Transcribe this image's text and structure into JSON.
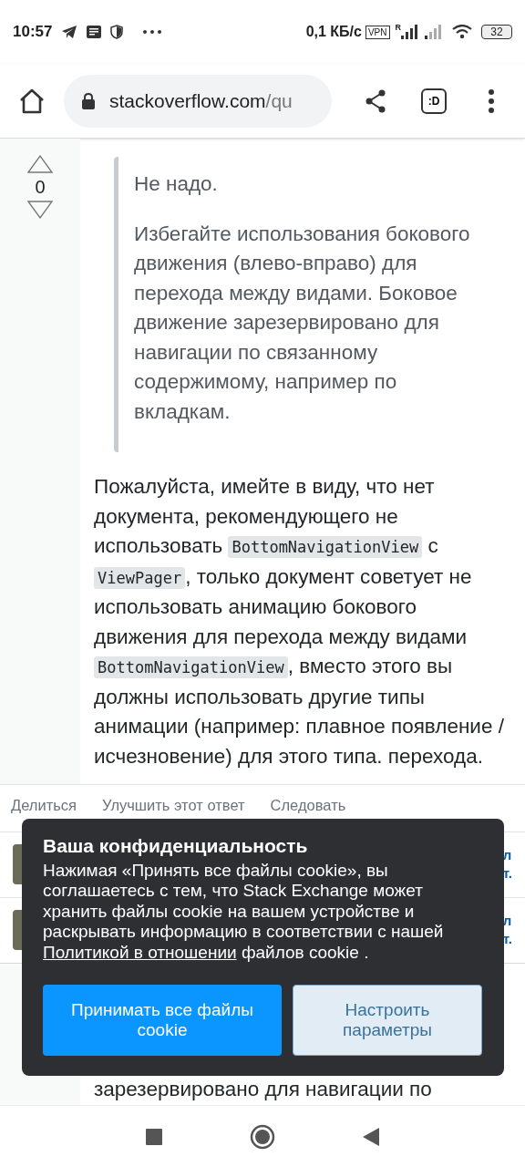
{
  "status_bar": {
    "time": "10:57",
    "net_speed": "0,1 КБ/с",
    "vpn": "VPN",
    "sim_roaming": "R",
    "battery": "32"
  },
  "browser": {
    "url_host": "stackoverflow.com",
    "url_rest": "/qu",
    "tab_count": ":D"
  },
  "answer": {
    "votes": "0",
    "quote": [
      "Не надо.",
      "Избегайте использования бокового движения (влево-вправо) для перехода между видами. Боковое движение зарезервировано для навигации по связанному содержимому, например по вкладкам."
    ],
    "paragraph": [
      {
        "kind": "text",
        "text": "Пожалуйста, имейте в виду, что нет документа, рекомендующего не использовать "
      },
      {
        "kind": "code",
        "text": "BottomNavigationView"
      },
      {
        "kind": "text",
        "text": " с "
      },
      {
        "kind": "code",
        "text": "ViewPager"
      },
      {
        "kind": "text",
        "text": ", только документ советует не использовать анимацию бокового движения для перехода между видами "
      },
      {
        "kind": "code",
        "text": "BottomNavigationView"
      },
      {
        "kind": "text",
        "text": ", вместо этого вы должны использовать другие типы анимации (например: плавное появление / исчезновение) для этого типа. перехода."
      }
    ],
    "actions": [
      "Делиться",
      "Улучшить этот ответ",
      "Следовать"
    ],
    "comments": [
      {
        "line_1": "л",
        "line_2": "т."
      },
      {
        "line_1": "л",
        "line_2": "т."
      }
    ]
  },
  "next_answer_line": "зарезервировано для навигации по",
  "cookie_dialog": {
    "title": "Ваша конфиденциальность",
    "body": "Нажимая «Принять все файлы cookie», вы соглашаетесь с тем, что Stack Exchange может хранить файлы cookie на вашем устройстве и раскрывать информацию в соответствии с нашей ",
    "link": "Политикой в отношении",
    "body_end": " файлов cookie .",
    "accept": "Принимать все файлы cookie",
    "customize": "Настроить параметры"
  }
}
